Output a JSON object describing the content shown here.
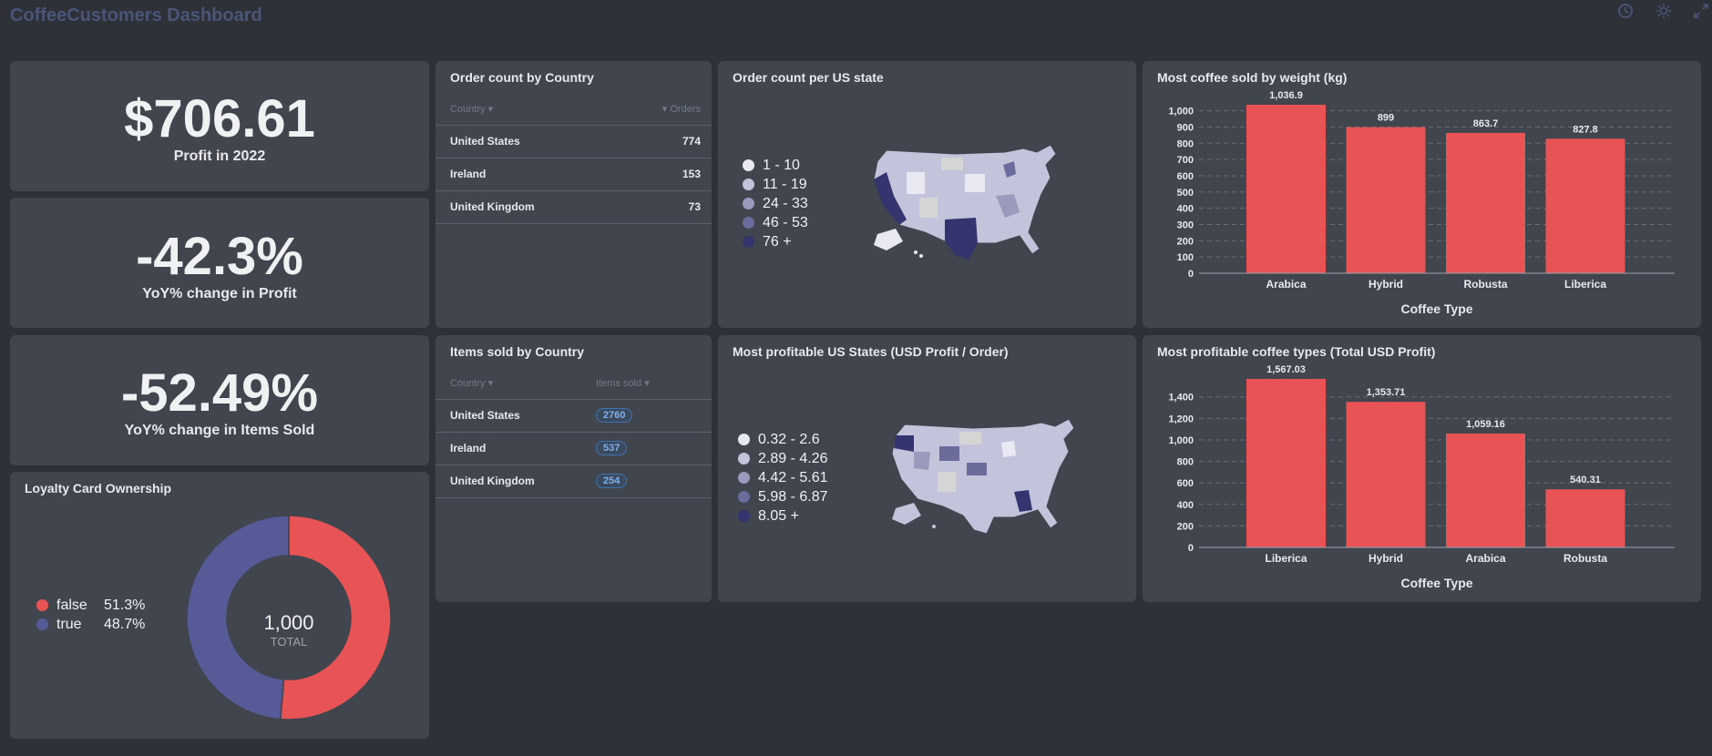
{
  "header": {
    "title": "CoffeeCustomers Dashboard",
    "icons": [
      "clock-icon",
      "sun-icon",
      "expand-icon"
    ]
  },
  "scalars": [
    {
      "value": "$706.61",
      "label": "Profit in 2022"
    },
    {
      "value": "-42.3%",
      "label": "YoY% change in Profit"
    },
    {
      "value": "-52.49%",
      "label": "YoY% change in Items Sold"
    }
  ],
  "orders_by_country": {
    "title": "Order count by Country",
    "columns": [
      "Country",
      "Orders"
    ],
    "rows": [
      {
        "country": "United States",
        "value": "774"
      },
      {
        "country": "Ireland",
        "value": "153"
      },
      {
        "country": "United Kingdom",
        "value": "73"
      }
    ]
  },
  "items_by_country": {
    "title": "Items sold by Country",
    "columns": [
      "Country",
      "Items sold"
    ],
    "rows": [
      {
        "country": "United States",
        "value": "2760"
      },
      {
        "country": "Ireland",
        "value": "537"
      },
      {
        "country": "United Kingdom",
        "value": "254"
      }
    ]
  },
  "orders_map": {
    "title": "Order count per US state",
    "legend": [
      "1 - 10",
      "11 - 19",
      "24 - 33",
      "46 - 53",
      "76 +"
    ],
    "colors": [
      "#e9e9f4",
      "#c3c3dc",
      "#9a9abd",
      "#6c6c9c",
      "#34346e"
    ]
  },
  "profit_map": {
    "title": "Most profitable US States (USD Profit / Order)",
    "legend": [
      "0.32 - 2.6",
      "2.89 - 4.26",
      "4.42 - 5.61",
      "5.98 - 6.87",
      "8.05 +"
    ],
    "colors": [
      "#e9e9f4",
      "#c3c3dc",
      "#9a9abd",
      "#6c6c9c",
      "#34346e"
    ]
  },
  "loyalty": {
    "title": "Loyalty Card Ownership",
    "total": "1,000",
    "total_label": "TOTAL",
    "items": [
      {
        "label": "false",
        "pct": "51.3%",
        "color": "#e85456"
      },
      {
        "label": "true",
        "pct": "48.7%",
        "color": "#565a96"
      }
    ]
  },
  "chart_data": [
    {
      "type": "bar",
      "title": "Most coffee sold by weight (kg)",
      "xlabel": "Coffee Type",
      "ylabel": "",
      "categories": [
        "Arabica",
        "Hybrid",
        "Robusta",
        "Liberica"
      ],
      "values": [
        1036.9,
        899,
        863.7,
        827.8
      ],
      "value_labels": [
        "1,036.9",
        "899",
        "863.7",
        "827.8"
      ],
      "yticks": [
        0,
        100,
        200,
        300,
        400,
        500,
        600,
        700,
        800,
        900,
        1000
      ],
      "ytick_labels": [
        "0",
        "100",
        "200",
        "300",
        "400",
        "500",
        "600",
        "700",
        "800",
        "900",
        "1,000"
      ],
      "ylim": [
        0,
        1036.9
      ],
      "color": "#e85456"
    },
    {
      "type": "bar",
      "title": "Most profitable coffee types (Total USD Profit)",
      "xlabel": "Coffee Type",
      "ylabel": "",
      "categories": [
        "Liberica",
        "Hybrid",
        "Arabica",
        "Robusta"
      ],
      "values": [
        1567.03,
        1353.71,
        1059.16,
        540.31
      ],
      "value_labels": [
        "1,567.03",
        "1,353.71",
        "1,059.16",
        "540.31"
      ],
      "yticks": [
        0,
        200,
        400,
        600,
        800,
        1000,
        1200,
        1400
      ],
      "ytick_labels": [
        "0",
        "200",
        "400",
        "600",
        "800",
        "1,000",
        "1,200",
        "1,400"
      ],
      "ylim": [
        0,
        1567.03
      ],
      "color": "#e85456"
    }
  ]
}
